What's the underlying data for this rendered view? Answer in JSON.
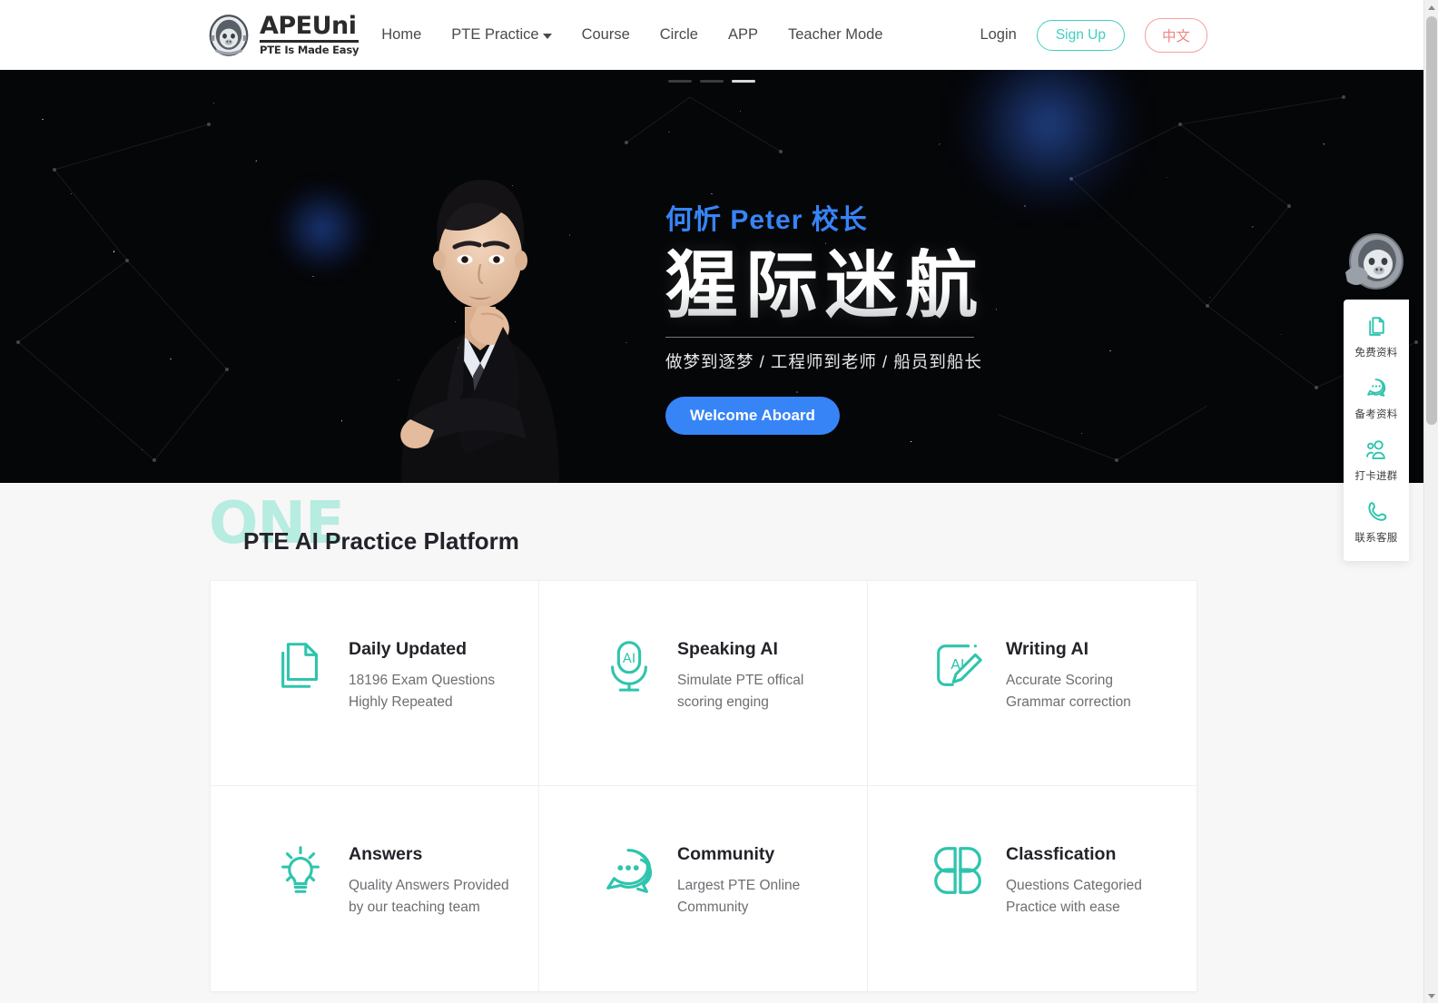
{
  "brand": {
    "name": "APEUni",
    "tagline": "PTE Is Made Easy",
    "logo_icon": "ape-astronaut-logo"
  },
  "nav": {
    "items": [
      {
        "label": "Home",
        "icon": null
      },
      {
        "label": "PTE Practice",
        "icon": "chevron-down-icon"
      },
      {
        "label": "Course",
        "icon": null
      },
      {
        "label": "Circle",
        "icon": null
      },
      {
        "label": "APP",
        "icon": null
      },
      {
        "label": "Teacher Mode",
        "icon": null
      }
    ],
    "login_label": "Login",
    "signup_label": "Sign Up",
    "language_label": "中文"
  },
  "hero": {
    "kicker": "何忻 Peter 校长",
    "title": "猩际迷航",
    "subtitle": "做梦到逐梦 / 工程师到老师 / 船员到船长",
    "cta_label": "Welcome Aboard",
    "slides_total": 3,
    "active_slide": 3
  },
  "section": {
    "ghost_word": "ONE",
    "title": "PTE AI Practice Platform"
  },
  "features": [
    {
      "icon": "documents-icon",
      "title": "Daily Updated",
      "line1": "18196 Exam Questions",
      "line2": "Highly Repeated"
    },
    {
      "icon": "microphone-ai-icon",
      "title": "Speaking AI",
      "line1": "Simulate PTE offical",
      "line2": "scoring enging"
    },
    {
      "icon": "ai-pencil-icon",
      "title": "Writing AI",
      "line1": "Accurate Scoring",
      "line2": "Grammar correction"
    },
    {
      "icon": "lightbulb-icon",
      "title": "Answers",
      "line1": "Quality Answers Provided",
      "line2": "by our teaching team"
    },
    {
      "icon": "chat-bubbles-icon",
      "title": "Community",
      "line1": "Largest PTE Online",
      "line2": "Community"
    },
    {
      "icon": "four-petals-icon",
      "title": "Classfication",
      "line1": "Questions Categoried",
      "line2": "Practice with ease"
    }
  ],
  "side_widget": {
    "mascot_icon": "ape-astronaut-mascot",
    "items": [
      {
        "icon": "document-icon",
        "label": "免费资料"
      },
      {
        "icon": "chat-icon",
        "label": "备考资料"
      },
      {
        "icon": "group-people-icon",
        "label": "打卡进群"
      },
      {
        "icon": "phone-icon",
        "label": "联系客服"
      }
    ]
  },
  "colors": {
    "accent_teal": "#2fc4ad",
    "accent_blue": "#3784f7",
    "ghost_mint": "#b7ece0",
    "lang_pink": "#ef8585",
    "page_bg": "#f7f7f8"
  }
}
